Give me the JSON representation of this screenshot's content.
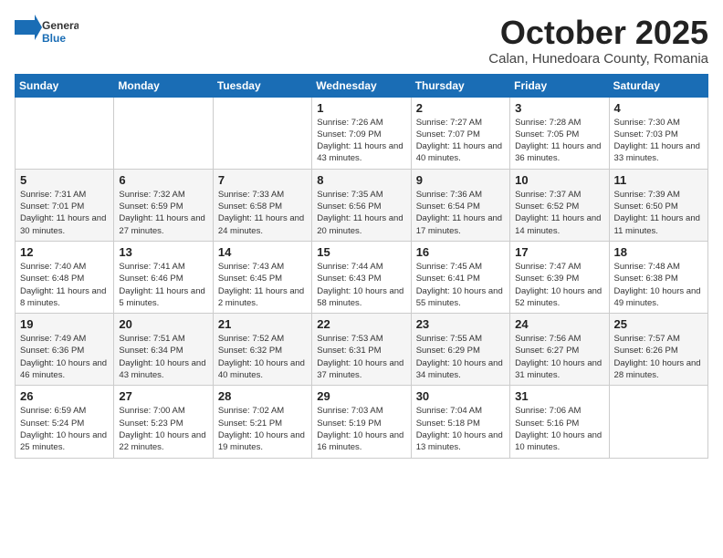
{
  "header": {
    "logo_general": "General",
    "logo_blue": "Blue",
    "month_title": "October 2025",
    "location": "Calan, Hunedoara County, Romania"
  },
  "days_of_week": [
    "Sunday",
    "Monday",
    "Tuesday",
    "Wednesday",
    "Thursday",
    "Friday",
    "Saturday"
  ],
  "weeks": [
    [
      {
        "day": "",
        "info": ""
      },
      {
        "day": "",
        "info": ""
      },
      {
        "day": "",
        "info": ""
      },
      {
        "day": "1",
        "info": "Sunrise: 7:26 AM\nSunset: 7:09 PM\nDaylight: 11 hours and 43 minutes."
      },
      {
        "day": "2",
        "info": "Sunrise: 7:27 AM\nSunset: 7:07 PM\nDaylight: 11 hours and 40 minutes."
      },
      {
        "day": "3",
        "info": "Sunrise: 7:28 AM\nSunset: 7:05 PM\nDaylight: 11 hours and 36 minutes."
      },
      {
        "day": "4",
        "info": "Sunrise: 7:30 AM\nSunset: 7:03 PM\nDaylight: 11 hours and 33 minutes."
      }
    ],
    [
      {
        "day": "5",
        "info": "Sunrise: 7:31 AM\nSunset: 7:01 PM\nDaylight: 11 hours and 30 minutes."
      },
      {
        "day": "6",
        "info": "Sunrise: 7:32 AM\nSunset: 6:59 PM\nDaylight: 11 hours and 27 minutes."
      },
      {
        "day": "7",
        "info": "Sunrise: 7:33 AM\nSunset: 6:58 PM\nDaylight: 11 hours and 24 minutes."
      },
      {
        "day": "8",
        "info": "Sunrise: 7:35 AM\nSunset: 6:56 PM\nDaylight: 11 hours and 20 minutes."
      },
      {
        "day": "9",
        "info": "Sunrise: 7:36 AM\nSunset: 6:54 PM\nDaylight: 11 hours and 17 minutes."
      },
      {
        "day": "10",
        "info": "Sunrise: 7:37 AM\nSunset: 6:52 PM\nDaylight: 11 hours and 14 minutes."
      },
      {
        "day": "11",
        "info": "Sunrise: 7:39 AM\nSunset: 6:50 PM\nDaylight: 11 hours and 11 minutes."
      }
    ],
    [
      {
        "day": "12",
        "info": "Sunrise: 7:40 AM\nSunset: 6:48 PM\nDaylight: 11 hours and 8 minutes."
      },
      {
        "day": "13",
        "info": "Sunrise: 7:41 AM\nSunset: 6:46 PM\nDaylight: 11 hours and 5 minutes."
      },
      {
        "day": "14",
        "info": "Sunrise: 7:43 AM\nSunset: 6:45 PM\nDaylight: 11 hours and 2 minutes."
      },
      {
        "day": "15",
        "info": "Sunrise: 7:44 AM\nSunset: 6:43 PM\nDaylight: 10 hours and 58 minutes."
      },
      {
        "day": "16",
        "info": "Sunrise: 7:45 AM\nSunset: 6:41 PM\nDaylight: 10 hours and 55 minutes."
      },
      {
        "day": "17",
        "info": "Sunrise: 7:47 AM\nSunset: 6:39 PM\nDaylight: 10 hours and 52 minutes."
      },
      {
        "day": "18",
        "info": "Sunrise: 7:48 AM\nSunset: 6:38 PM\nDaylight: 10 hours and 49 minutes."
      }
    ],
    [
      {
        "day": "19",
        "info": "Sunrise: 7:49 AM\nSunset: 6:36 PM\nDaylight: 10 hours and 46 minutes."
      },
      {
        "day": "20",
        "info": "Sunrise: 7:51 AM\nSunset: 6:34 PM\nDaylight: 10 hours and 43 minutes."
      },
      {
        "day": "21",
        "info": "Sunrise: 7:52 AM\nSunset: 6:32 PM\nDaylight: 10 hours and 40 minutes."
      },
      {
        "day": "22",
        "info": "Sunrise: 7:53 AM\nSunset: 6:31 PM\nDaylight: 10 hours and 37 minutes."
      },
      {
        "day": "23",
        "info": "Sunrise: 7:55 AM\nSunset: 6:29 PM\nDaylight: 10 hours and 34 minutes."
      },
      {
        "day": "24",
        "info": "Sunrise: 7:56 AM\nSunset: 6:27 PM\nDaylight: 10 hours and 31 minutes."
      },
      {
        "day": "25",
        "info": "Sunrise: 7:57 AM\nSunset: 6:26 PM\nDaylight: 10 hours and 28 minutes."
      }
    ],
    [
      {
        "day": "26",
        "info": "Sunrise: 6:59 AM\nSunset: 5:24 PM\nDaylight: 10 hours and 25 minutes."
      },
      {
        "day": "27",
        "info": "Sunrise: 7:00 AM\nSunset: 5:23 PM\nDaylight: 10 hours and 22 minutes."
      },
      {
        "day": "28",
        "info": "Sunrise: 7:02 AM\nSunset: 5:21 PM\nDaylight: 10 hours and 19 minutes."
      },
      {
        "day": "29",
        "info": "Sunrise: 7:03 AM\nSunset: 5:19 PM\nDaylight: 10 hours and 16 minutes."
      },
      {
        "day": "30",
        "info": "Sunrise: 7:04 AM\nSunset: 5:18 PM\nDaylight: 10 hours and 13 minutes."
      },
      {
        "day": "31",
        "info": "Sunrise: 7:06 AM\nSunset: 5:16 PM\nDaylight: 10 hours and 10 minutes."
      },
      {
        "day": "",
        "info": ""
      }
    ]
  ]
}
